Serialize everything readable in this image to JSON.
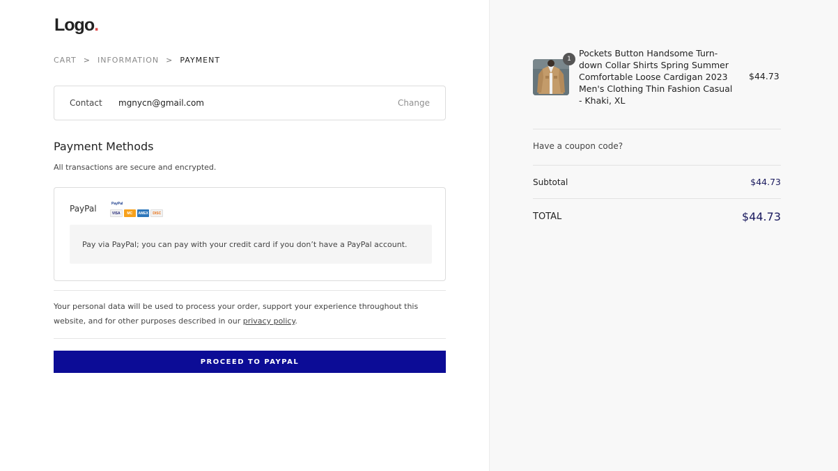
{
  "logo": {
    "text": "Logo",
    "dot": "."
  },
  "breadcrumb": {
    "items": [
      {
        "label": "CART"
      },
      {
        "label": "INFORMATION"
      },
      {
        "label": "PAYMENT"
      }
    ],
    "separator": ">"
  },
  "contact": {
    "label": "Contact",
    "email": "mgnycn@gmail.com",
    "change_label": "Change"
  },
  "payment": {
    "heading": "Payment Methods",
    "subtext": "All transactions are secure and encrypted.",
    "method_label": "PayPal",
    "card_logos": [
      "VISA",
      "MC",
      "AMEX",
      "DISC"
    ],
    "description": "Pay via PayPal; you can pay with your credit card if you don’t have a PayPal account."
  },
  "privacy": {
    "text_before": "Your personal data will be used to process your order, support your experience throughout this website, and for other purposes described in our ",
    "link_label": "privacy policy",
    "text_after": "."
  },
  "proceed_button": {
    "label": "PROCEED TO PAYPAL"
  },
  "order": {
    "product": {
      "quantity": "1",
      "name": "Pockets Button Handsome Turn-down Collar Shirts Spring Summer Comfortable Loose Cardigan 2023 Men's Clothing Thin Fashion Casual - Khaki, XL",
      "price": "$44.73"
    },
    "coupon_label": "Have a coupon code?",
    "subtotal_label": "Subtotal",
    "subtotal_value": "$44.73",
    "total_label": "TOTAL",
    "total_value": "$44.73"
  },
  "colors": {
    "button": "#0c0c96",
    "price_text": "#1a1a5e",
    "logo_dot": "#e04b4b",
    "sidebar_bg": "#f8f8f8"
  }
}
